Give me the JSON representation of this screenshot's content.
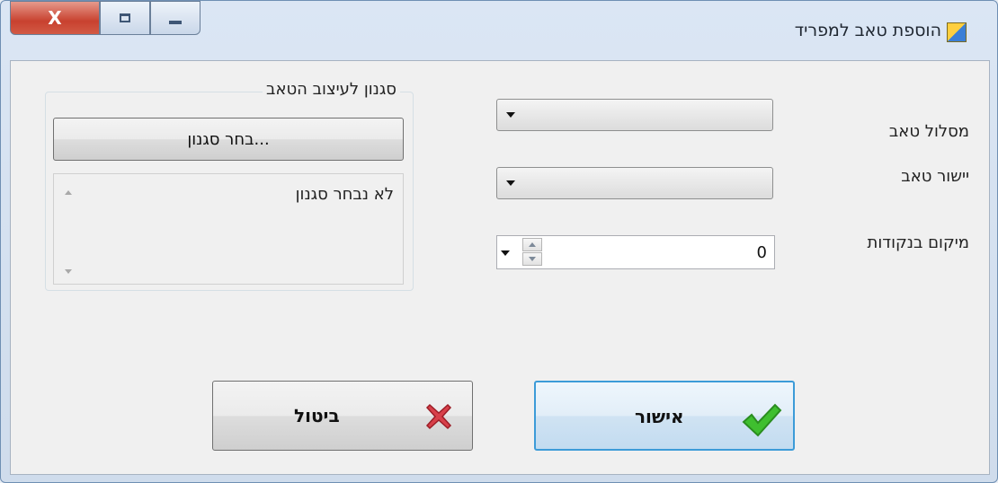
{
  "window": {
    "title": "הוספת טאב למפריד",
    "close_label": "X"
  },
  "form": {
    "tab_path_label": "מסלול טאב",
    "tab_align_label": "יישור טאב",
    "position_label": "מיקום בנקודות",
    "position_value": "0"
  },
  "style_group": {
    "title": "סגנון לעיצוב הטאב",
    "choose_button": "בחר סגנון...",
    "selected_text": "לא נבחר סגנון"
  },
  "buttons": {
    "ok": "אישור",
    "cancel": "ביטול"
  },
  "colors": {
    "ok_icon": "#3fbf2f",
    "cancel_icon": "#d8404a"
  }
}
